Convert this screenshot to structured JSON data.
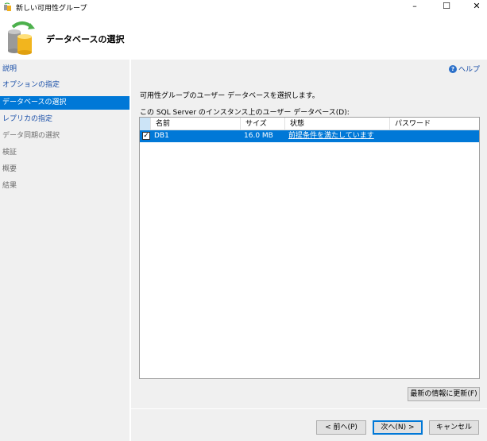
{
  "window": {
    "title": "新しい可用性グループ",
    "minimize": "–",
    "maximize": "☐",
    "close": "✕"
  },
  "header": {
    "title": "データベースの選択"
  },
  "nav": {
    "items": [
      {
        "label": "説明",
        "state": "link"
      },
      {
        "label": "オプションの指定",
        "state": "link"
      },
      {
        "label": "データベースの選択",
        "state": "selected"
      },
      {
        "label": "レプリカの指定",
        "state": "link"
      },
      {
        "label": "データ同期の選択",
        "state": "disabled"
      },
      {
        "label": "検証",
        "state": "disabled"
      },
      {
        "label": "概要",
        "state": "disabled"
      },
      {
        "label": "結果",
        "state": "disabled"
      }
    ]
  },
  "help": {
    "label": "ヘルプ",
    "icon": "?"
  },
  "content": {
    "description": "可用性グループのユーザー データベースを選択します。",
    "table_label": "この SQL Server のインスタンス上のユーザー データベース(D):",
    "columns": [
      "名前",
      "サイズ",
      "状態",
      "パスワード"
    ],
    "rows": [
      {
        "checked": true,
        "check": "✓",
        "name": "DB1",
        "size": "16.0 MB",
        "status": "前提条件を満たしています",
        "password": ""
      }
    ]
  },
  "buttons": {
    "refresh": "最新の情報に更新(F)",
    "prev": "< 前へ(P)",
    "next": "次へ(N) >",
    "cancel": "キャンセル"
  }
}
